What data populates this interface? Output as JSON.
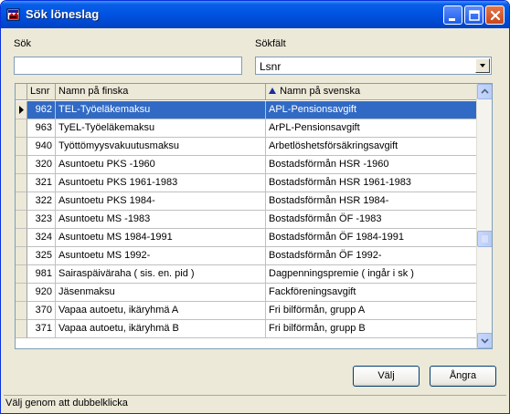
{
  "window": {
    "title": "Sök löneslag"
  },
  "search": {
    "label": "Sök",
    "value": ""
  },
  "field": {
    "label": "Sökfält",
    "selected": "Lsnr"
  },
  "grid": {
    "columns": {
      "lsnr": "Lsnr",
      "finnish": "Namn på finska",
      "swedish": "Namn på svenska"
    },
    "sort_column": "swedish",
    "sort_direction": "ascending",
    "selected_row": 0,
    "rows": [
      {
        "lsnr": "962",
        "fi": "TEL-Työeläkemaksu",
        "sv": "APL-Pensionsavgift"
      },
      {
        "lsnr": "963",
        "fi": "TyEL-Työeläkemaksu",
        "sv": "ArPL-Pensionsavgift"
      },
      {
        "lsnr": "940",
        "fi": "Työttömyysvakuutusmaksu",
        "sv": "Arbetlöshetsförsäkringsavgift"
      },
      {
        "lsnr": "320",
        "fi": "Asuntoetu PKS -1960",
        "sv": "Bostadsförmån HSR -1960"
      },
      {
        "lsnr": "321",
        "fi": "Asuntoetu PKS 1961-1983",
        "sv": "Bostadsförmån HSR 1961-1983"
      },
      {
        "lsnr": "322",
        "fi": "Asuntoetu PKS 1984-",
        "sv": "Bostadsförmån HSR 1984-"
      },
      {
        "lsnr": "323",
        "fi": "Asuntoetu MS -1983",
        "sv": "Bostadsförmån ÖF -1983"
      },
      {
        "lsnr": "324",
        "fi": "Asuntoetu MS 1984-1991",
        "sv": "Bostadsförmån ÖF 1984-1991"
      },
      {
        "lsnr": "325",
        "fi": "Asuntoetu MS 1992-",
        "sv": "Bostadsförmån ÖF 1992-"
      },
      {
        "lsnr": "981",
        "fi": "Sairaspäiväraha ( sis. en. pid )",
        "sv": "Dagpenningspremie ( ingår i sk )"
      },
      {
        "lsnr": "920",
        "fi": "Jäsenmaksu",
        "sv": "Fackföreningsavgift"
      },
      {
        "lsnr": "370",
        "fi": "Vapaa autoetu, ikäryhmä A",
        "sv": "Fri bilförmån, grupp A"
      },
      {
        "lsnr": "371",
        "fi": "Vapaa autoetu, ikäryhmä B",
        "sv": "Fri bilförmån, grupp B"
      }
    ]
  },
  "buttons": {
    "ok": "Välj",
    "cancel": "Ångra"
  },
  "status": "Välj genom att dubbelklicka",
  "icons": {
    "app": "app-icon",
    "minimize": "minimize-icon",
    "maximize": "maximize-icon",
    "close": "close-icon",
    "dropdown": "chevron-down-icon",
    "row_indicator": "row-pointer-icon",
    "sort": "sort-ascending-icon"
  },
  "colors": {
    "titlebar": "#0054e3",
    "selection": "#316ac5",
    "face": "#ece9d8"
  }
}
